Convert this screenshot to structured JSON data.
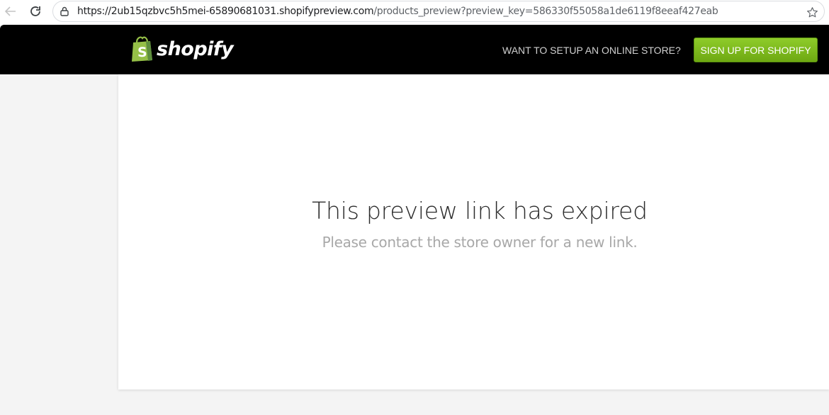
{
  "browser": {
    "url_host": "https://2ub15qzbvc5h5mei-65890681031.shopifypreview.com",
    "url_path": "/products_preview?preview_key=586330f55058a1de6119f8eeaf427eab",
    "icons": [
      "back-arrow-icon",
      "reload-icon",
      "lock-icon",
      "star-icon"
    ]
  },
  "header": {
    "logo_text": "shopify",
    "setup_prompt": "WANT TO SETUP AN ONLINE STORE?",
    "signup_label": "SIGN UP FOR SHOPIFY"
  },
  "main": {
    "title": "This preview link has expired",
    "subtitle": "Please contact the store owner for a new link."
  },
  "colors": {
    "header_bg": "#000000",
    "signup_green": "#7bbd1e",
    "logo_bag_green": "#95bf47",
    "page_bg": "#f4f4f4"
  }
}
